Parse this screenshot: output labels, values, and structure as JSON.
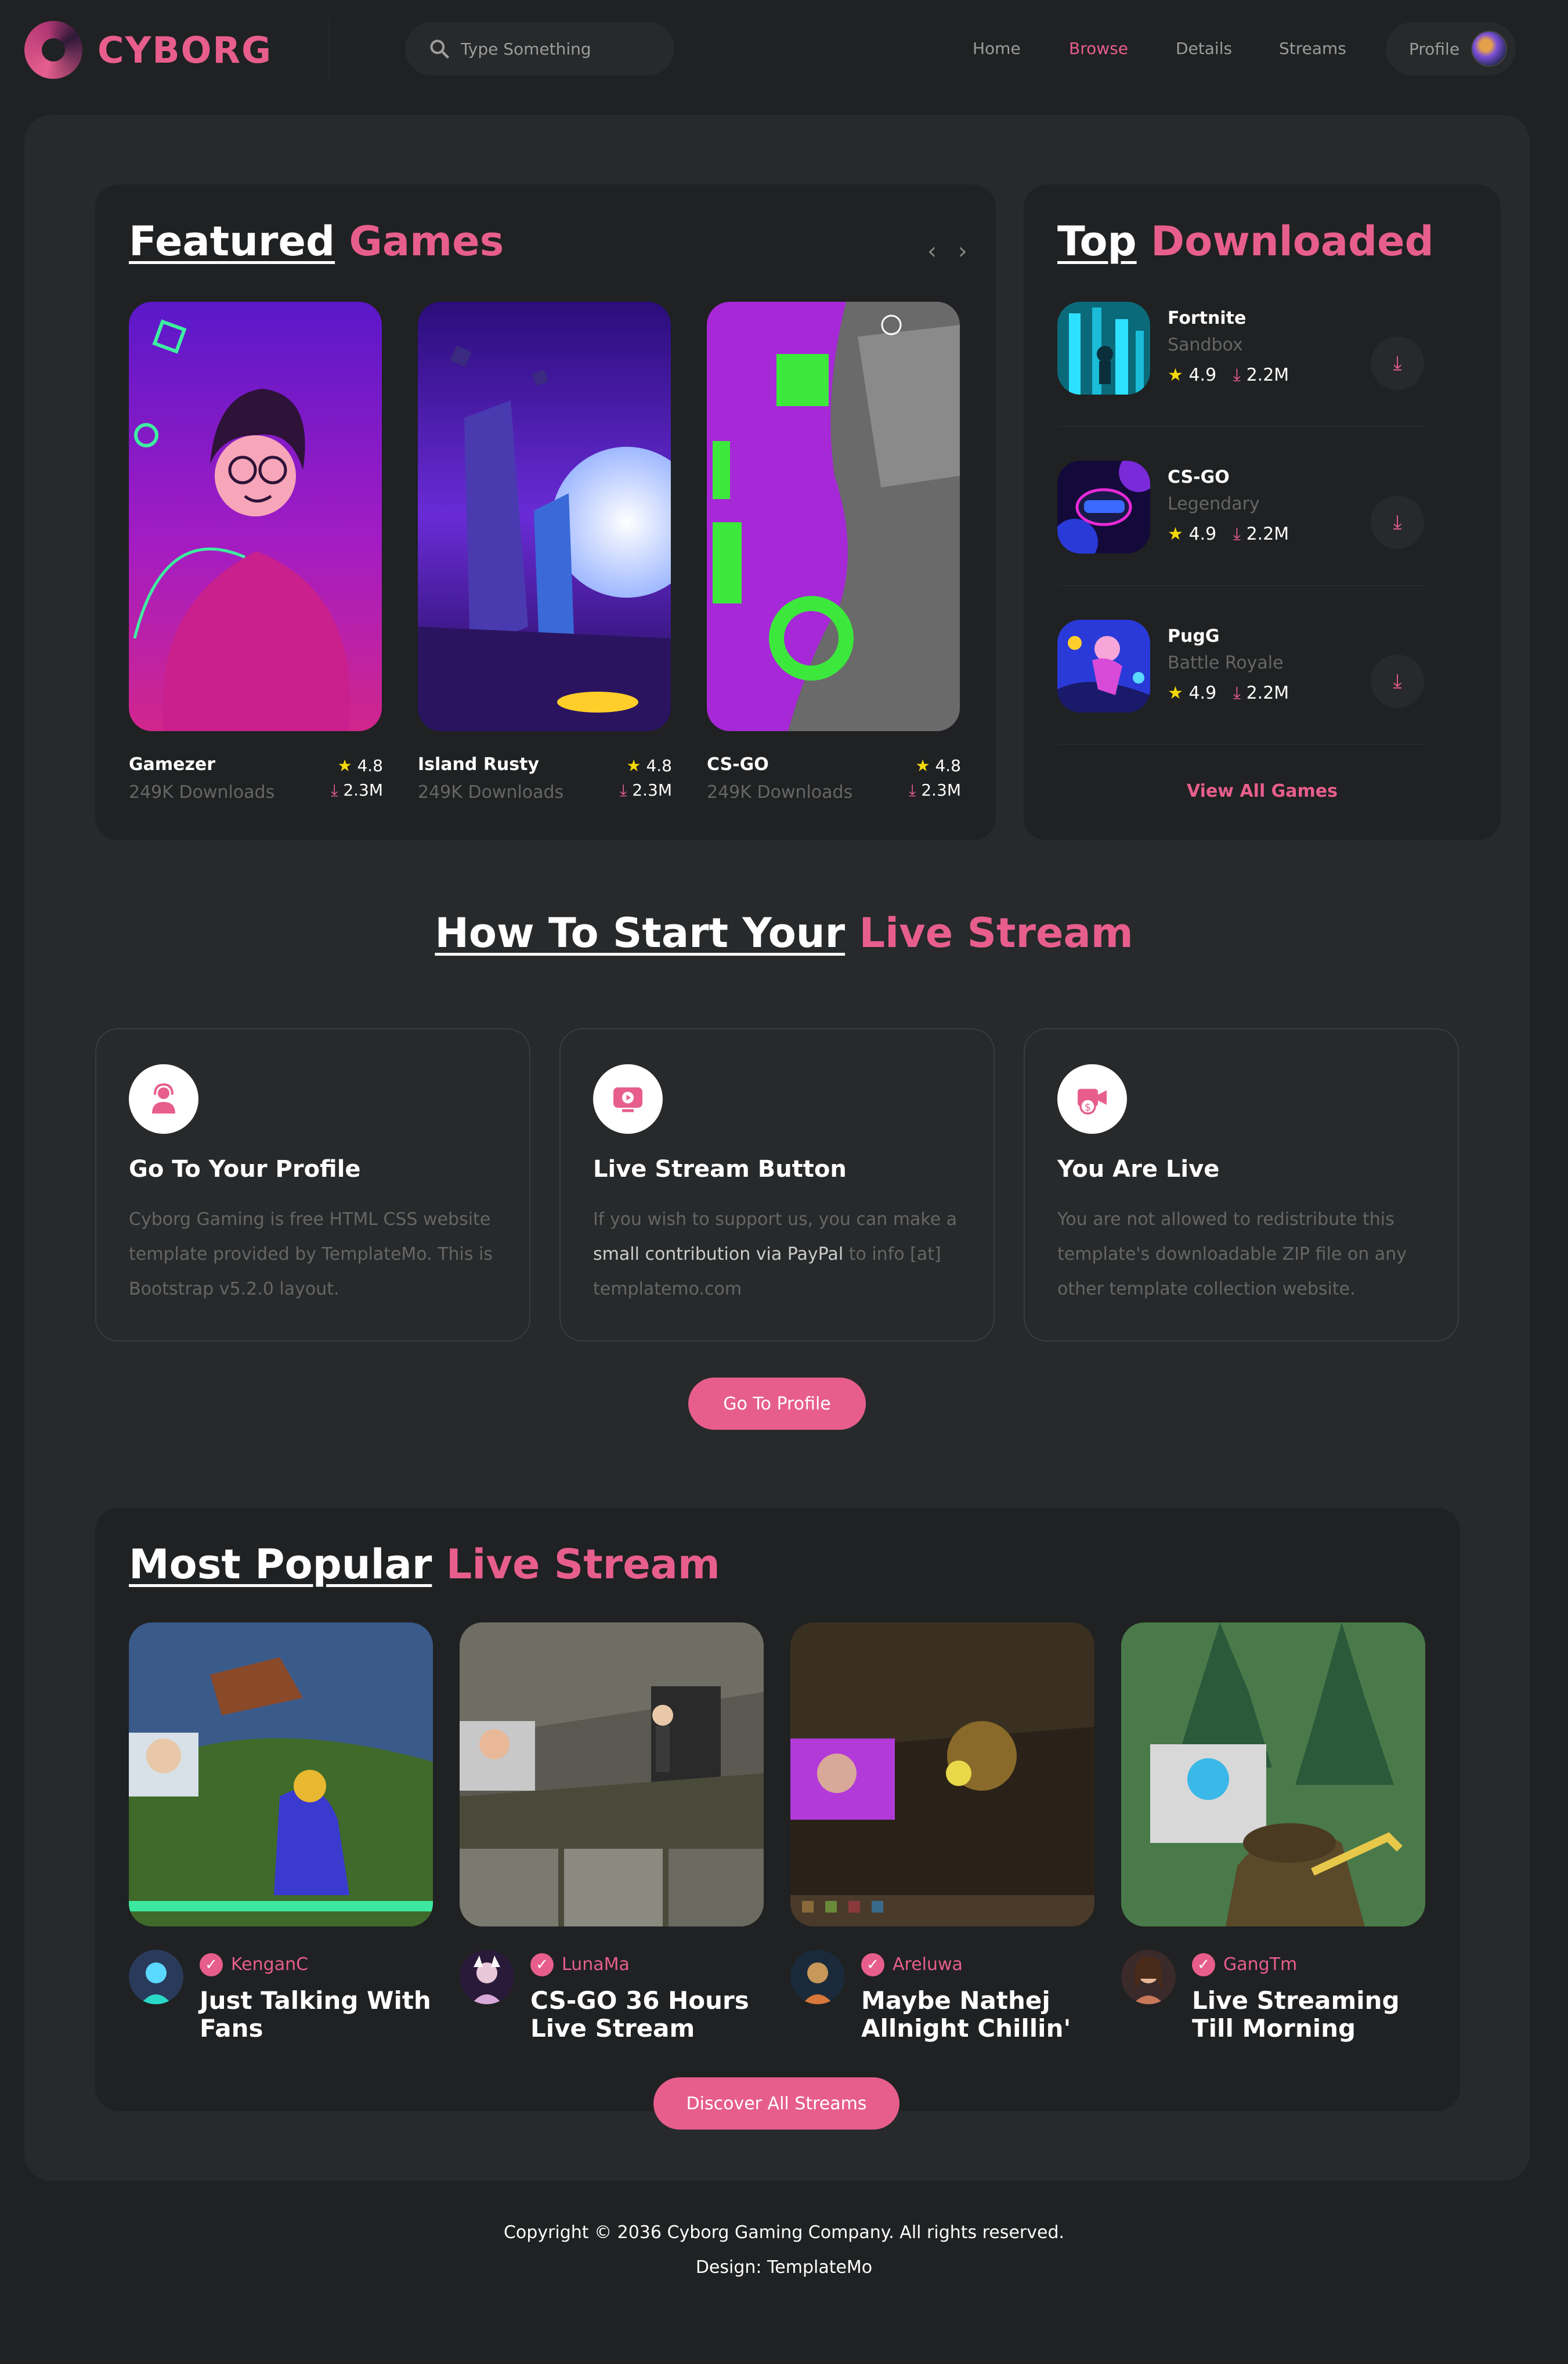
{
  "brand": {
    "name": "CYBORG",
    "accent": "#e75e8d"
  },
  "search": {
    "placeholder": "Type Something"
  },
  "nav": [
    {
      "label": "Home",
      "active": false
    },
    {
      "label": "Browse",
      "active": true
    },
    {
      "label": "Details",
      "active": false
    },
    {
      "label": "Streams",
      "active": false
    }
  ],
  "profile": {
    "label": "Profile"
  },
  "featured": {
    "title_plain": "Featured",
    "title_accent": "Games",
    "arrows": "‹ ›",
    "games": [
      {
        "name": "Gamezer",
        "downloads": "249K Downloads",
        "rating": "4.8",
        "count": "2.3M"
      },
      {
        "name": "Island Rusty",
        "downloads": "249K Downloads",
        "rating": "4.8",
        "count": "2.3M"
      },
      {
        "name": "CS-GO",
        "downloads": "249K Downloads",
        "rating": "4.8",
        "count": "2.3M"
      }
    ]
  },
  "top_downloaded": {
    "title_plain": "Top",
    "title_accent": "Downloaded",
    "items": [
      {
        "name": "Fortnite",
        "category": "Sandbox",
        "rating": "4.9",
        "count": "2.2M"
      },
      {
        "name": "CS-GO",
        "category": "Legendary",
        "rating": "4.9",
        "count": "2.2M"
      },
      {
        "name": "PugG",
        "category": "Battle Royale",
        "rating": "4.9",
        "count": "2.2M"
      }
    ],
    "view_all": "View All Games"
  },
  "howto": {
    "title_plain": "How To Start Your",
    "title_accent": "Live Stream",
    "steps": [
      {
        "title": "Go To Your Profile",
        "text": "Cyborg Gaming is free HTML CSS website template provided by TemplateMo. This is Bootstrap v5.2.0 layout."
      },
      {
        "title": "Live Stream Button",
        "text_a": "If you wish to support us, you can make a ",
        "text_hl": "small contribution via PayPal",
        "text_b": " to info [at] templatemo.com"
      },
      {
        "title": "You Are Live",
        "text": "You are not allowed to redistribute this template's downloadable ZIP file on any other template collection website."
      }
    ],
    "button": "Go To Profile"
  },
  "popular": {
    "title_plain": "Most Popular",
    "title_accent": "Live Stream",
    "streams": [
      {
        "user": "KenganC",
        "title": "Just Talking With Fans"
      },
      {
        "user": "LunaMa",
        "title": "CS-GO 36 Hours Live Stream"
      },
      {
        "user": "Areluwa",
        "title": "Maybe Nathej Allnight Chillin'"
      },
      {
        "user": "GangTm",
        "title": "Live Streaming Till Morning"
      }
    ],
    "button": "Discover All Streams"
  },
  "footer": {
    "copyright": "Copyright © 2036 Cyborg Gaming Company. All rights reserved.",
    "design": "Design: TemplateMo"
  }
}
